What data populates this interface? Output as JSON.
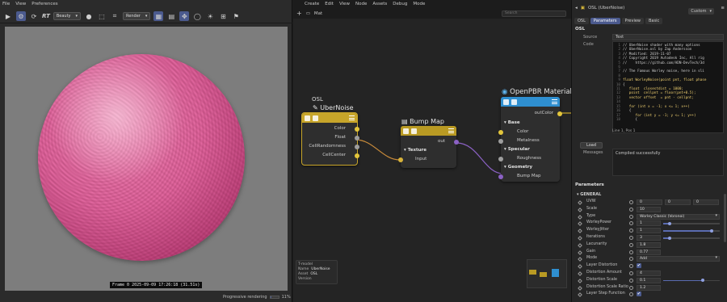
{
  "viewer": {
    "menu": [
      "File",
      "View",
      "Preferences"
    ],
    "toolbar": {
      "rt_label": "RT",
      "channel": "Beauty",
      "camera_select": "Render"
    },
    "frame_caption": "Frame 0  2025-09-09 17:26:18 (31.51s)",
    "progressive_label": "Progressive rendering",
    "progressive_value": "11%",
    "progressive_fraction": 0.11,
    "sphere_color": "#e66aa3"
  },
  "node_editor": {
    "menu": [
      "Create",
      "Edit",
      "View",
      "Node",
      "Assets",
      "Debug",
      "Mode"
    ],
    "tab": "Mat",
    "search_placeholder": "Search",
    "nodes": {
      "osl": {
        "group_label": "OSL",
        "title": "UberNoise",
        "color": "#c7a52a",
        "ports": [
          "Color",
          "Float",
          "CellRandomness",
          "CellCenter"
        ]
      },
      "bump": {
        "title": "Bump Map",
        "color": "#b99a23",
        "output": "out",
        "section": "Texture",
        "input": "Input"
      },
      "openpbr": {
        "title": "OpenPBR Material",
        "color": "#2f8fd0",
        "output": "outColor",
        "sections": [
          "Base",
          "Specular",
          "Geometry"
        ],
        "base_ports": [
          "Color",
          "Metalness"
        ],
        "specular_ports": [
          "Roughness"
        ],
        "geometry_ports": [
          "Bump Map"
        ]
      }
    },
    "info": {
      "type_label": "T-model",
      "name_label": "Name",
      "name_value": "UberNoise",
      "asset_label": "Asset",
      "asset_value": "OSL",
      "version_label": "Version"
    }
  },
  "attributes": {
    "title": "OSL (UberNoise)",
    "layout_select": "Custom",
    "tabs": [
      "OSL",
      "Parameters",
      "Preview",
      "Basic"
    ],
    "section": "OSL",
    "source_label": "Source",
    "source_value": "Text",
    "code_label": "Code",
    "code_lines": [
      {
        "n": "1",
        "t": "// UberNoise shader with many options"
      },
      {
        "n": "2",
        "t": "// UberNoise.osl by Zap Andersson"
      },
      {
        "n": "3",
        "t": "// Modified: 2019-11-07"
      },
      {
        "n": "4",
        "t": "// Copyright 2019 Autodesk Inc, All rig"
      },
      {
        "n": "5",
        "t": "//    https://github.com/ADN-DevTech/3d"
      },
      {
        "n": "6",
        "t": ""
      },
      {
        "n": "7",
        "t": "// The Famous Worley noise, here in sli"
      },
      {
        "n": "8",
        "t": ""
      },
      {
        "n": "9",
        "t": "float WorleyNoise(point pnt, float phase"
      },
      {
        "n": "10",
        "t": "{"
      },
      {
        "n": "11",
        "t": "   float  closestdist = 1000;"
      },
      {
        "n": "12",
        "t": "   point  cellpnt = floor(pnt+0.5);"
      },
      {
        "n": "13",
        "t": "   vector offset  = pnt - cellpnt;"
      },
      {
        "n": "14",
        "t": ""
      },
      {
        "n": "15",
        "t": "   for (int x = -1; x <= 1; x++)"
      },
      {
        "n": "16",
        "t": "   {"
      },
      {
        "n": "17",
        "t": "      for (int y = -1; y <= 1; y++)"
      },
      {
        "n": "18",
        "t": "      {"
      }
    ],
    "code_status": "Line 1, Pos 1",
    "load_button": "Load",
    "messages_label": "Messages",
    "messages_value": "Compiled successfully",
    "params_title": "Parameters",
    "general_label": "GENERAL",
    "params": [
      {
        "label": "UVW",
        "kind": "vec",
        "values": [
          "0",
          "0",
          "0"
        ]
      },
      {
        "label": "Scale",
        "kind": "num",
        "value": "10"
      },
      {
        "label": "Type",
        "kind": "select",
        "value": "Worley Classic (Voronoi)"
      },
      {
        "label": "WorleyPower",
        "kind": "slider",
        "value": "1",
        "fraction": 0.12
      },
      {
        "label": "WorleyJitter",
        "kind": "slider",
        "value": "1",
        "fraction": 0.85
      },
      {
        "label": "Iterations",
        "kind": "slider",
        "value": "3",
        "fraction": 0.12
      },
      {
        "label": "Lacunarity",
        "kind": "num",
        "value": "1.8"
      },
      {
        "label": "Gain",
        "kind": "num",
        "value": "0.77"
      },
      {
        "label": "Mode",
        "kind": "select",
        "value": "Add"
      },
      {
        "label": "Layer Distortion",
        "kind": "check",
        "value": "✔"
      },
      {
        "label": "Distortion Amount",
        "kind": "num",
        "value": "4"
      },
      {
        "label": "Distortion Scale",
        "kind": "slider",
        "value": "0.1",
        "fraction": 0.7
      },
      {
        "label": "Distortion Scale Ratio",
        "kind": "num",
        "value": "1.2"
      },
      {
        "label": "Layer Step Function",
        "kind": "check",
        "value": "✔"
      }
    ]
  }
}
